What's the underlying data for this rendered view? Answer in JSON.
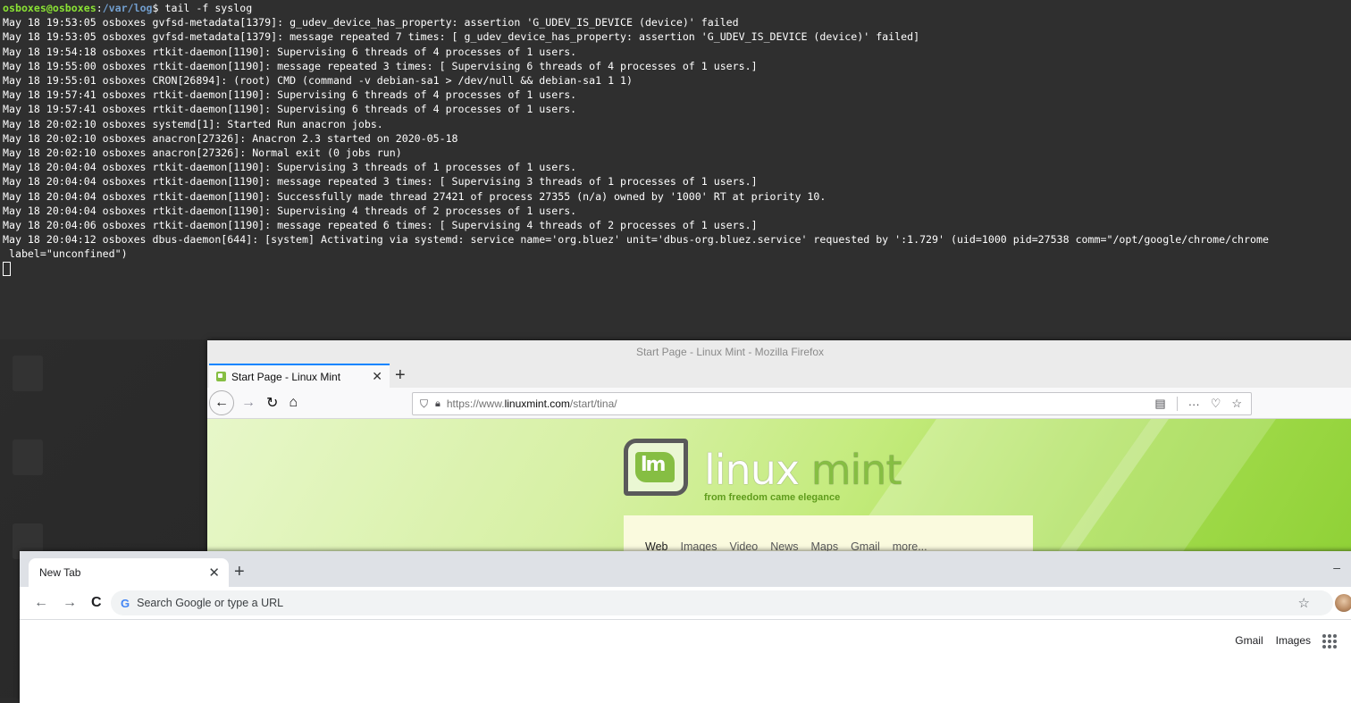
{
  "terminal": {
    "prompt_user": "osboxes@osboxes",
    "prompt_path": "/var/log",
    "command": "$ tail -f syslog",
    "lines": [
      "May 18 19:53:05 osboxes gvfsd-metadata[1379]: g_udev_device_has_property: assertion 'G_UDEV_IS_DEVICE (device)' failed",
      "May 18 19:53:05 osboxes gvfsd-metadata[1379]: message repeated 7 times: [ g_udev_device_has_property: assertion 'G_UDEV_IS_DEVICE (device)' failed]",
      "May 18 19:54:18 osboxes rtkit-daemon[1190]: Supervising 6 threads of 4 processes of 1 users.",
      "May 18 19:55:00 osboxes rtkit-daemon[1190]: message repeated 3 times: [ Supervising 6 threads of 4 processes of 1 users.]",
      "May 18 19:55:01 osboxes CRON[26894]: (root) CMD (command -v debian-sa1 > /dev/null && debian-sa1 1 1)",
      "May 18 19:57:41 osboxes rtkit-daemon[1190]: Supervising 6 threads of 4 processes of 1 users.",
      "May 18 19:57:41 osboxes rtkit-daemon[1190]: Supervising 6 threads of 4 processes of 1 users.",
      "May 18 20:02:10 osboxes systemd[1]: Started Run anacron jobs.",
      "May 18 20:02:10 osboxes anacron[27326]: Anacron 2.3 started on 2020-05-18",
      "May 18 20:02:10 osboxes anacron[27326]: Normal exit (0 jobs run)",
      "May 18 20:04:04 osboxes rtkit-daemon[1190]: Supervising 3 threads of 1 processes of 1 users.",
      "May 18 20:04:04 osboxes rtkit-daemon[1190]: message repeated 3 times: [ Supervising 3 threads of 1 processes of 1 users.]",
      "May 18 20:04:04 osboxes rtkit-daemon[1190]: Successfully made thread 27421 of process 27355 (n/a) owned by '1000' RT at priority 10.",
      "May 18 20:04:04 osboxes rtkit-daemon[1190]: Supervising 4 threads of 2 processes of 1 users.",
      "May 18 20:04:06 osboxes rtkit-daemon[1190]: message repeated 6 times: [ Supervising 4 threads of 2 processes of 1 users.]",
      "May 18 20:04:12 osboxes dbus-daemon[644]: [system] Activating via systemd: service name='org.bluez' unit='dbus-org.bluez.service' requested by ':1.729' (uid=1000 pid=27538 comm=\"/opt/google/chrome/chrome",
      " label=\"unconfined\")"
    ]
  },
  "firefox": {
    "window_title": "Start Page - Linux Mint - Mozilla Firefox",
    "tab_title": "Start Page - Linux Mint",
    "url_prefix": "https://www.",
    "url_domain": "linuxmint.com",
    "url_suffix": "/start/tina/",
    "page": {
      "logo_word_a": "linux",
      "logo_word_b": "mint",
      "tagline": "from freedom came elegance",
      "search_links": [
        "Web",
        "Images",
        "Video",
        "News",
        "Maps",
        "Gmail",
        "more..."
      ]
    }
  },
  "chrome": {
    "tab_title": "New Tab",
    "omnibox_placeholder": "Search Google or type a URL",
    "links": [
      "Gmail",
      "Images"
    ]
  },
  "colors": {
    "terminal_bg": "#2f2f2f",
    "prompt_user": "#8ae234",
    "prompt_path": "#729fcf",
    "mint_green": "#86be43",
    "firefox_accent": "#0a84ff"
  }
}
